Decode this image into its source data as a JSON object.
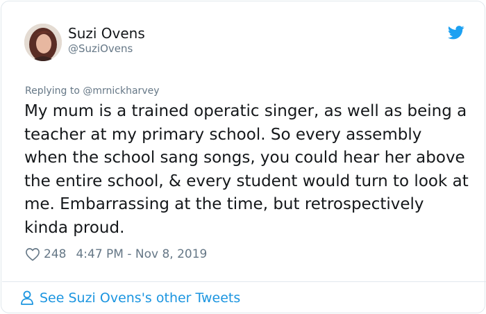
{
  "tweet": {
    "author": {
      "display_name": "Suzi Ovens",
      "handle": "@SuziOvens"
    },
    "brand_icon": "twitter-bird-icon",
    "replying_to_label": "Replying to",
    "replying_to_handle": "@mrnickharvey",
    "text": "My mum is a trained operatic singer, as well as being a teacher at my primary school. So every assembly when the school sang songs, you could hear her above the entire school, & every student would turn to look at me. Embarrassing at the time, but retrospectively kinda proud.",
    "likes": "248",
    "timestamp": "4:47 PM - Nov 8, 2019",
    "footer_link": "See Suzi Ovens's other Tweets"
  },
  "colors": {
    "twitter_blue": "#1DA1F2",
    "link_blue": "#1B95E0",
    "secondary_text": "#657786",
    "border": "#E1E8ED"
  }
}
